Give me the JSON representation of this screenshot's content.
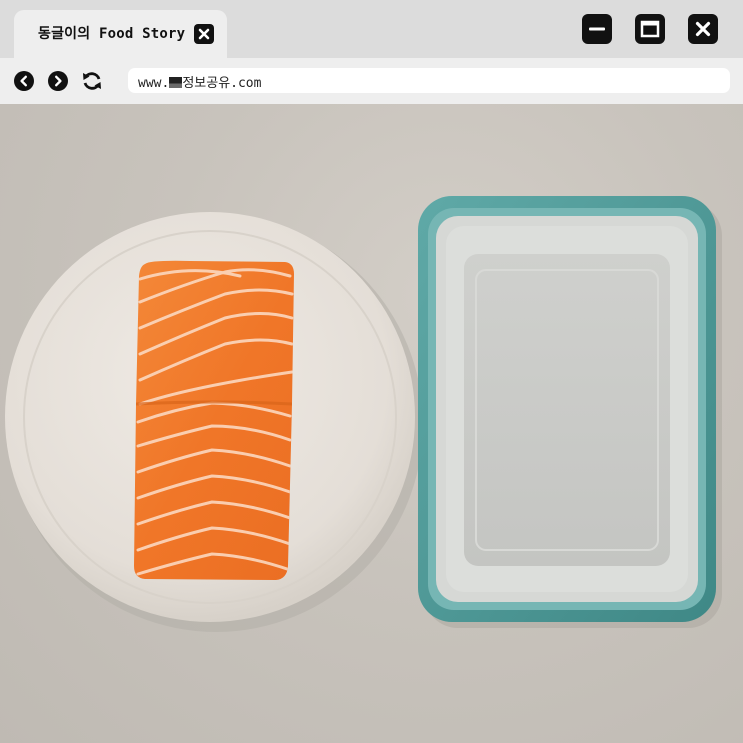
{
  "browser": {
    "tab_title": "동글이의 Food Story",
    "url_prefix": "www.",
    "url_rest": "정보공유.com"
  },
  "icons": {
    "tab_close": "close-icon",
    "minimize": "minimize-icon",
    "maximize": "maximize-icon",
    "close": "close-icon",
    "back": "chevron-left-icon",
    "forward": "chevron-right-icon",
    "reload": "reload-icon",
    "url_flag": "flag-icon"
  },
  "colors": {
    "chrome_bg": "#dcdcdc",
    "tab_bg": "#eeeeee",
    "button_dark": "#111111",
    "salmon": "#f07a2c",
    "container_rim": "#4f9c9b"
  }
}
